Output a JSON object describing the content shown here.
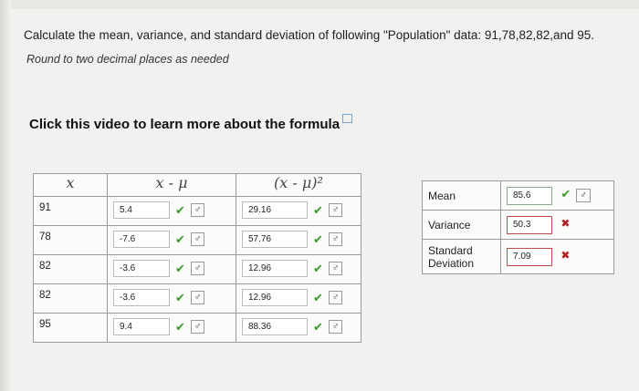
{
  "question": "Calculate the mean, variance, and standard deviation of following \"Population\" data: 91,78,82,82,and 95.",
  "hint": "Round to two decimal places as needed",
  "video_link": "Click this video to learn more about the formula",
  "table": {
    "headers": [
      "x",
      "x - μ",
      "(x - μ)²"
    ],
    "rows": [
      {
        "x": "91",
        "dev": "5.4",
        "sq": "29.16"
      },
      {
        "x": "78",
        "dev": "-7.6",
        "sq": "57.76"
      },
      {
        "x": "82",
        "dev": "-3.6",
        "sq": "12.96"
      },
      {
        "x": "82",
        "dev": "-3.6",
        "sq": "12.96"
      },
      {
        "x": "95",
        "dev": "9.4",
        "sq": "88.36"
      }
    ]
  },
  "summary": [
    {
      "label": "Mean",
      "value": "85.6",
      "status": "correct"
    },
    {
      "label": "Variance",
      "value": "50.3",
      "status": "incorrect"
    },
    {
      "label": "Standard Deviation",
      "value": "7.09",
      "status": "incorrect"
    }
  ],
  "glyphs": {
    "check": "✔",
    "cross": "✖",
    "gender": "♂"
  },
  "colors": {
    "correct": "#3a9a2e",
    "incorrect": "#b22222"
  }
}
